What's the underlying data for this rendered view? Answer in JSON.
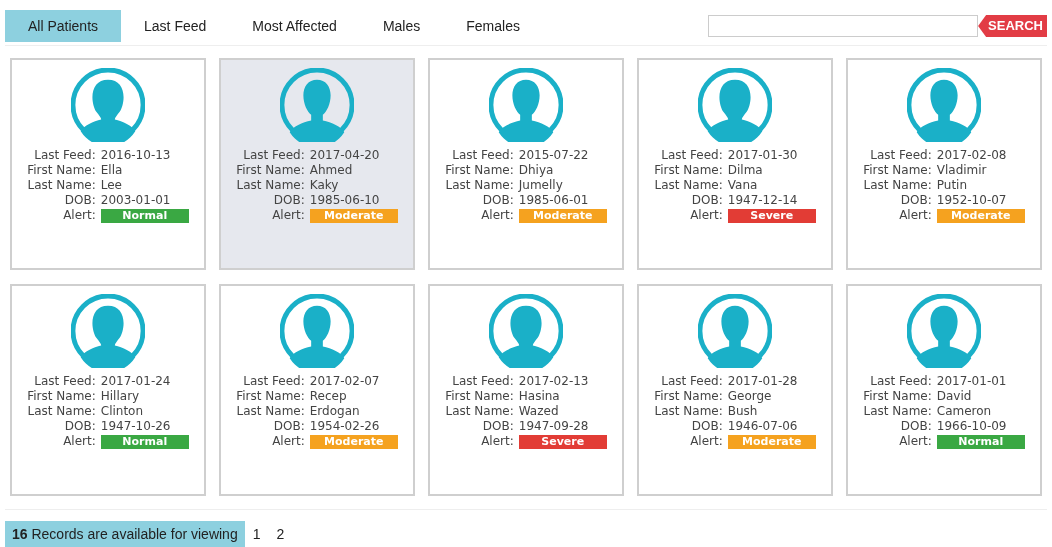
{
  "tabs": [
    {
      "label": "All Patients",
      "selected": true
    },
    {
      "label": "Last Feed",
      "selected": false
    },
    {
      "label": "Most Affected",
      "selected": false
    },
    {
      "label": "Males",
      "selected": false
    },
    {
      "label": "Females",
      "selected": false
    }
  ],
  "search": {
    "button": "SEARCH"
  },
  "patients": [
    {
      "kind": "female",
      "selected": false,
      "fields": [
        {
          "label": "Last Feed:",
          "value": "2016-10-13"
        },
        {
          "label": "First Name:",
          "value": "Ella"
        },
        {
          "label": "Last Name:",
          "value": "Lee"
        },
        {
          "label": "DOB:",
          "value": "2003-01-01"
        }
      ],
      "alert": {
        "label": "Alert:",
        "kind": "normal",
        "value": "Normal"
      }
    },
    {
      "kind": "male",
      "selected": true,
      "fields": [
        {
          "label": "Last Feed:",
          "value": "2017-04-20"
        },
        {
          "label": "First Name:",
          "value": "Ahmed"
        },
        {
          "label": "Last Name:",
          "value": "Kaky"
        },
        {
          "label": "DOB:",
          "value": "1985-06-10"
        }
      ],
      "alert": {
        "label": "Alert:",
        "kind": "moderate",
        "value": "Moderate"
      }
    },
    {
      "kind": "male",
      "selected": false,
      "fields": [
        {
          "label": "Last Feed:",
          "value": "2015-07-22"
        },
        {
          "label": "First Name:",
          "value": "Dhiya"
        },
        {
          "label": "Last Name:",
          "value": "Jumelly"
        },
        {
          "label": "DOB:",
          "value": "1985-06-01"
        }
      ],
      "alert": {
        "label": "Alert:",
        "kind": "moderate",
        "value": "Moderate"
      }
    },
    {
      "kind": "female",
      "selected": false,
      "fields": [
        {
          "label": "Last Feed:",
          "value": "2017-01-30"
        },
        {
          "label": "First Name:",
          "value": "Dilma"
        },
        {
          "label": "Last Name:",
          "value": "Vana"
        },
        {
          "label": "DOB:",
          "value": "1947-12-14"
        }
      ],
      "alert": {
        "label": "Alert:",
        "kind": "severe",
        "value": "Severe"
      }
    },
    {
      "kind": "male",
      "selected": false,
      "fields": [
        {
          "label": "Last Feed:",
          "value": "2017-02-08"
        },
        {
          "label": "First Name:",
          "value": "Vladimir"
        },
        {
          "label": "Last Name:",
          "value": "Putin"
        },
        {
          "label": "DOB:",
          "value": "1952-10-07"
        }
      ],
      "alert": {
        "label": "Alert:",
        "kind": "moderate",
        "value": "Moderate"
      }
    },
    {
      "kind": "female",
      "selected": false,
      "fields": [
        {
          "label": "Last Feed:",
          "value": "2017-01-24"
        },
        {
          "label": "First Name:",
          "value": "Hillary"
        },
        {
          "label": "Last Name:",
          "value": "Clinton"
        },
        {
          "label": "DOB:",
          "value": "1947-10-26"
        }
      ],
      "alert": {
        "label": "Alert:",
        "kind": "normal",
        "value": "Normal"
      }
    },
    {
      "kind": "male",
      "selected": false,
      "fields": [
        {
          "label": "Last Feed:",
          "value": "2017-02-07"
        },
        {
          "label": "First Name:",
          "value": "Recep"
        },
        {
          "label": "Last Name:",
          "value": "Erdogan"
        },
        {
          "label": "DOB:",
          "value": "1954-02-26"
        }
      ],
      "alert": {
        "label": "Alert:",
        "kind": "moderate",
        "value": "Moderate"
      }
    },
    {
      "kind": "female",
      "selected": false,
      "fields": [
        {
          "label": "Last Feed:",
          "value": "2017-02-13"
        },
        {
          "label": "First Name:",
          "value": "Hasina"
        },
        {
          "label": "Last Name:",
          "value": "Wazed"
        },
        {
          "label": "DOB:",
          "value": "1947-09-28"
        }
      ],
      "alert": {
        "label": "Alert:",
        "kind": "severe",
        "value": "Severe"
      }
    },
    {
      "kind": "male",
      "selected": false,
      "fields": [
        {
          "label": "Last Feed:",
          "value": "2017-01-28"
        },
        {
          "label": "First Name:",
          "value": "George"
        },
        {
          "label": "Last Name:",
          "value": "Bush"
        },
        {
          "label": "DOB:",
          "value": "1946-07-06"
        }
      ],
      "alert": {
        "label": "Alert:",
        "kind": "moderate",
        "value": "Moderate"
      }
    },
    {
      "kind": "male",
      "selected": false,
      "fields": [
        {
          "label": "Last Feed:",
          "value": "2017-01-01"
        },
        {
          "label": "First Name:",
          "value": "David"
        },
        {
          "label": "Last Name:",
          "value": "Cameron"
        },
        {
          "label": "DOB:",
          "value": "1966-10-09"
        }
      ],
      "alert": {
        "label": "Alert:",
        "kind": "normal",
        "value": "Normal"
      }
    }
  ],
  "footer": {
    "records": "**16** Records are available for viewing",
    "pages": [
      {
        "label": "1",
        "selected": false
      },
      {
        "label": "2",
        "selected": false
      }
    ]
  }
}
